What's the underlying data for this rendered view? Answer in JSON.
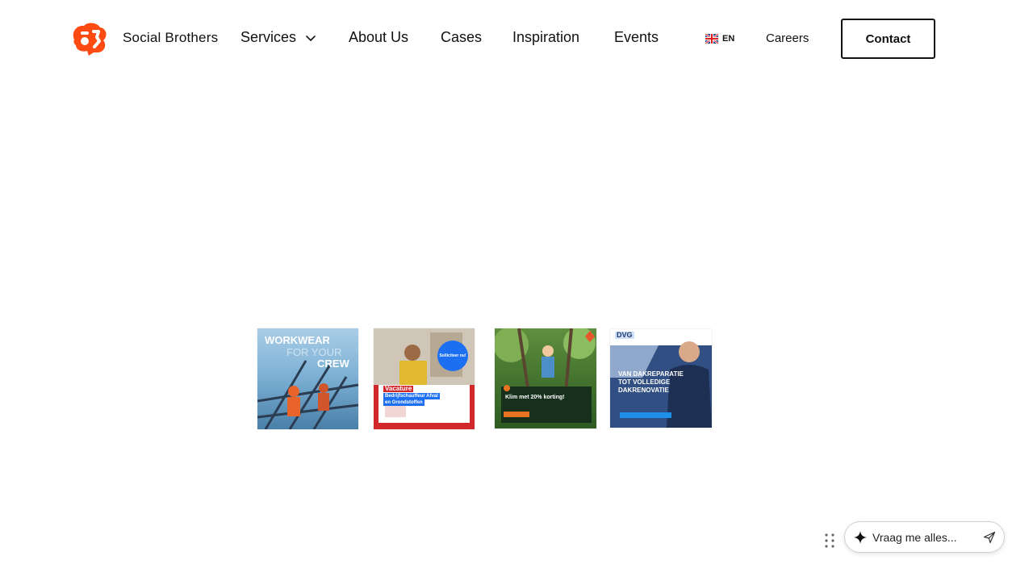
{
  "brand": {
    "name": "Social Brothers",
    "logo_color": "#ff4b12"
  },
  "nav": {
    "items": [
      {
        "label": "Services",
        "has_dropdown": true
      },
      {
        "label": "About Us"
      },
      {
        "label": "Cases"
      },
      {
        "label": "Inspiration"
      },
      {
        "label": "Events"
      }
    ],
    "language": {
      "code": "EN",
      "flag": "uk-flag-icon"
    },
    "careers": "Careers",
    "contact": "Contact"
  },
  "ads": [
    {
      "lines": [
        "WORKWEAR",
        "FOR YOUR",
        "CREW"
      ]
    },
    {
      "badge": "Solliciteer nu!",
      "lines": [
        "Vacature",
        "Bedrijfschauffeur Afval",
        "en Grondstoffen"
      ]
    },
    {
      "lines": [
        "Klim met 20% korting!"
      ]
    },
    {
      "lines": [
        "DVG",
        "VAN DAKREPARATIE",
        "TOT VOLLEDIGE",
        "DAKRENOVATIE"
      ]
    }
  ],
  "chat": {
    "placeholder": "Vraag me alles...",
    "icon": "sparkle-icon",
    "send_icon": "send-icon"
  },
  "colors": {
    "accent": "#ff4b12",
    "text": "#111111",
    "border": "#111111"
  }
}
